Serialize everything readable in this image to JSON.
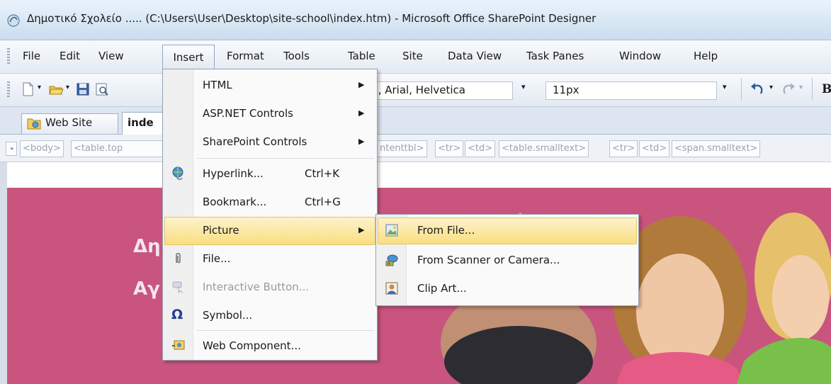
{
  "window": {
    "title": "Δημοτικό Σχολείο ..... (C:\\Users\\User\\Desktop\\site-school\\index.htm) - Microsoft Office SharePoint Designer"
  },
  "menubar": {
    "items": [
      "File",
      "Edit",
      "View",
      "Insert",
      "Format",
      "Tools",
      "Table",
      "Site",
      "Data View",
      "Task Panes",
      "Window",
      "Help"
    ]
  },
  "toolbar": {
    "font_value": "na, Arial, Helvetica",
    "size_value": "11px",
    "bold_label": "B"
  },
  "tabs": [
    {
      "label": "Web Site"
    },
    {
      "label": "inde"
    }
  ],
  "quick_tags": [
    "<body>",
    "<table.top",
    "ntenttbl>",
    "<tr>",
    "<td>",
    "<table.smalltext>",
    "<tr>",
    "<td>",
    "<span.smalltext>"
  ],
  "page": {
    "heading_line1": "Δη",
    "heading_line2": "Αγ"
  },
  "insert_menu": {
    "items": [
      {
        "label": "HTML",
        "shortcut": "",
        "submenu": true
      },
      {
        "label": "ASP.NET Controls",
        "shortcut": "",
        "submenu": true
      },
      {
        "label": "SharePoint Controls",
        "shortcut": "",
        "submenu": true
      },
      {
        "label": "Hyperlink...",
        "shortcut": "Ctrl+K",
        "submenu": false
      },
      {
        "label": "Bookmark...",
        "shortcut": "Ctrl+G",
        "submenu": false
      },
      {
        "label": "Picture",
        "shortcut": "",
        "submenu": true
      },
      {
        "label": "File...",
        "shortcut": "",
        "submenu": false
      },
      {
        "label": "Interactive Button...",
        "shortcut": "",
        "submenu": false,
        "disabled": true
      },
      {
        "label": "Symbol...",
        "shortcut": "",
        "submenu": false
      },
      {
        "label": "Web Component...",
        "shortcut": "",
        "submenu": false
      }
    ]
  },
  "picture_submenu": {
    "items": [
      {
        "label": "From File..."
      },
      {
        "label": "From Scanner or Camera..."
      },
      {
        "label": "Clip Art..."
      }
    ]
  },
  "colors": {
    "highlight": "#f9de80",
    "page_pink": "#c9557f",
    "menu_bg": "#fafafa"
  }
}
